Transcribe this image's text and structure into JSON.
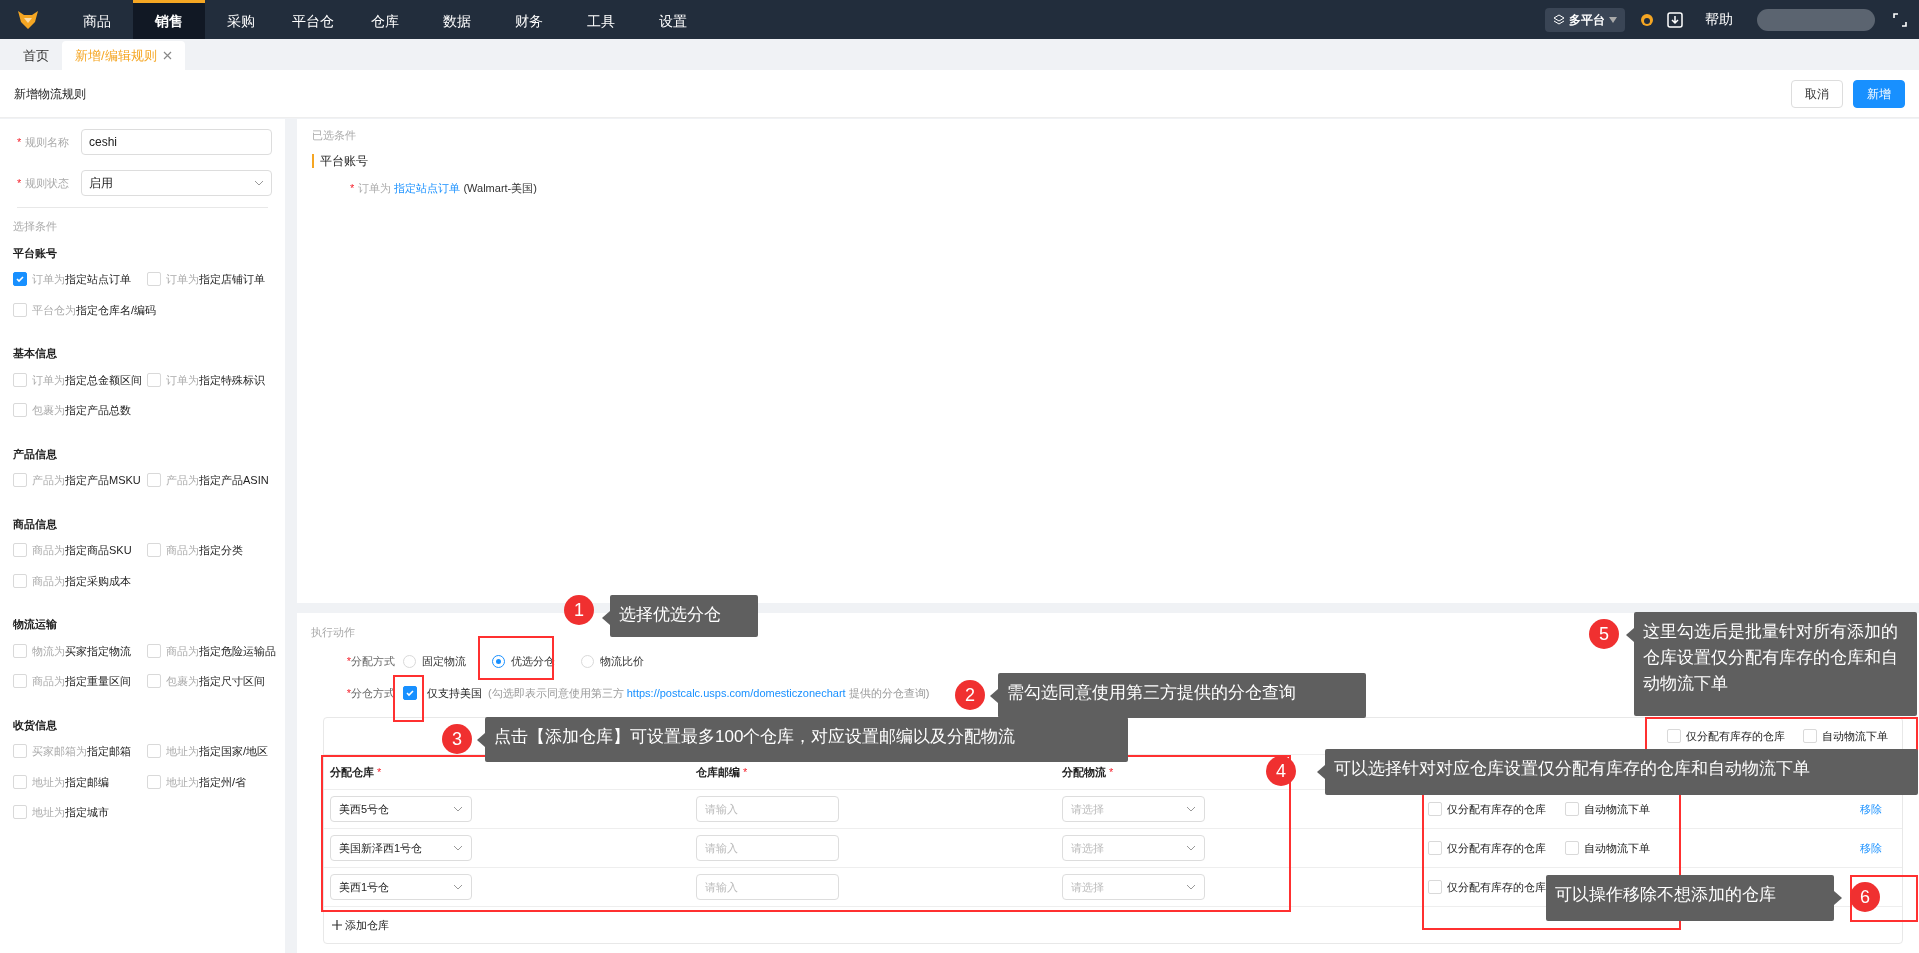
{
  "nav": {
    "items": [
      {
        "label": "商品",
        "selected": false
      },
      {
        "label": "销售",
        "selected": true
      },
      {
        "label": "采购",
        "selected": false
      },
      {
        "label": "平台仓",
        "selected": false
      },
      {
        "label": "仓库",
        "selected": false
      },
      {
        "label": "数据",
        "selected": false
      },
      {
        "label": "财务",
        "selected": false
      },
      {
        "label": "工具",
        "selected": false
      },
      {
        "label": "设置",
        "selected": false
      }
    ],
    "platform": "多平台",
    "help": "帮助"
  },
  "tabs": [
    {
      "label": "首页",
      "selected": false,
      "closable": false
    },
    {
      "label": "新增/编辑规则",
      "selected": true,
      "closable": true
    }
  ],
  "header": {
    "title": "新增物流规则",
    "buttons": [
      {
        "label": "取消",
        "kind": "default"
      },
      {
        "label": "新增",
        "kind": "primary"
      }
    ]
  },
  "form": {
    "fields": [
      {
        "mark": "*",
        "label": "规则名称",
        "kind": "input",
        "value": "ceshi"
      },
      {
        "mark": "*",
        "label": "规则状态",
        "kind": "select",
        "value": "启用"
      }
    ],
    "conditions_title": "选择条件",
    "groups": [
      {
        "title": "平台账号",
        "options": [
          {
            "prefix": "订单为",
            "target": "指定站点订单",
            "checked": true
          },
          {
            "prefix": "订单为",
            "target": "指定店铺订单",
            "checked": false
          },
          {
            "prefix": "平台仓为",
            "target": "指定仓库名/编码",
            "checked": false
          }
        ]
      },
      {
        "title": "基本信息",
        "options": [
          {
            "prefix": "订单为",
            "target": "指定总金额区间",
            "checked": false
          },
          {
            "prefix": "订单为",
            "target": "指定特殊标识",
            "checked": false
          },
          {
            "prefix": "包裹为",
            "target": "指定产品总数",
            "checked": false
          }
        ]
      },
      {
        "title": "产品信息",
        "options": [
          {
            "prefix": "产品为",
            "target": "指定产品MSKU",
            "checked": false
          },
          {
            "prefix": "产品为",
            "target": "指定产品ASIN",
            "checked": false
          }
        ]
      },
      {
        "title": "商品信息",
        "options": [
          {
            "prefix": "商品为",
            "target": "指定商品SKU",
            "checked": false
          },
          {
            "prefix": "商品为",
            "target": "指定分类",
            "checked": false
          },
          {
            "prefix": "商品为",
            "target": "指定采购成本",
            "checked": false
          }
        ]
      },
      {
        "title": "物流运输",
        "options": [
          {
            "prefix": "物流为",
            "target": "买家指定物流",
            "checked": false
          },
          {
            "prefix": "商品为",
            "target": "指定危险运输品",
            "checked": false
          },
          {
            "prefix": "商品为",
            "target": "指定重量区间",
            "checked": false
          },
          {
            "prefix": "包裹为",
            "target": "指定尺寸区间",
            "checked": false
          }
        ]
      },
      {
        "title": "收货信息",
        "options": [
          {
            "prefix": "买家邮箱为",
            "target": "指定邮箱",
            "checked": false
          },
          {
            "prefix": "地址为",
            "target": "指定国家/地区",
            "checked": false
          },
          {
            "prefix": "地址为",
            "target": "指定邮编",
            "checked": false
          },
          {
            "prefix": "地址为",
            "target": "指定州/省",
            "checked": false
          },
          {
            "prefix": "地址为",
            "target": "指定城市",
            "checked": false
          }
        ]
      }
    ]
  },
  "selected": {
    "title": "已选条件",
    "group": "平台账号",
    "rule": {
      "mark": "*",
      "prefix": "订单为",
      "link": "指定站点订单",
      "detail": "(Walmart-美国)"
    }
  },
  "action": {
    "title": "执行动作",
    "mode": {
      "mark": "*",
      "label": "分配方式",
      "options": [
        {
          "label": "固定物流",
          "selected": false
        },
        {
          "label": "优选分仓",
          "selected": true
        },
        {
          "label": "物流比价",
          "selected": false
        }
      ]
    },
    "split": {
      "mark": "*",
      "label": "分仓方式",
      "option": "仅支持美国",
      "checked": true,
      "note_before": "(勾选即表示同意使用第三方",
      "link": "https://postcalc.usps.com/domesticzonechart",
      "note_after": "提供的分仓查询)"
    },
    "batch": [
      {
        "label": "仅分配有库存的仓库",
        "checked": false
      },
      {
        "label": "自动物流下单",
        "checked": false
      }
    ],
    "columns": [
      {
        "label": "分配仓库",
        "mark": "*"
      },
      {
        "label": "仓库邮编",
        "mark": "*"
      },
      {
        "label": "分配物流",
        "mark": "*"
      }
    ],
    "rows": [
      {
        "warehouse": "美西5号仓",
        "zip_placeholder": "请输入",
        "logistics_placeholder": "请选择",
        "stock_label": "仅分配有库存的仓库",
        "stock": false,
        "auto_label": "自动物流下单",
        "auto": false,
        "remove": "移除"
      },
      {
        "warehouse": "美国新泽西1号仓",
        "zip_placeholder": "请输入",
        "logistics_placeholder": "请选择",
        "stock_label": "仅分配有库存的仓库",
        "stock": false,
        "auto_label": "自动物流下单",
        "auto": false,
        "remove": "移除"
      },
      {
        "warehouse": "美西1号仓",
        "zip_placeholder": "请输入",
        "logistics_placeholder": "请选择",
        "stock_label": "仅分配有库存的仓库",
        "stock": false
      }
    ],
    "add": "添加仓库"
  },
  "annotations": [
    {
      "number": "1",
      "text": "选择优选分仓"
    },
    {
      "number": "2",
      "text": "需勾选同意使用第三方提供的分仓查询"
    },
    {
      "number": "3",
      "text": "点击【添加仓库】可设置最多100个仓库，对应设置邮编以及分配物流"
    },
    {
      "number": "4",
      "text": "可以选择针对对应仓库设置仅分配有库存的仓库和自动物流下单"
    },
    {
      "number": "5",
      "text": "这里勾选后是批量针对所有添加的仓库设置仅分配有库存的仓库和自动物流下单"
    },
    {
      "number": "6",
      "text": "可以操作移除不想添加的仓库"
    }
  ]
}
